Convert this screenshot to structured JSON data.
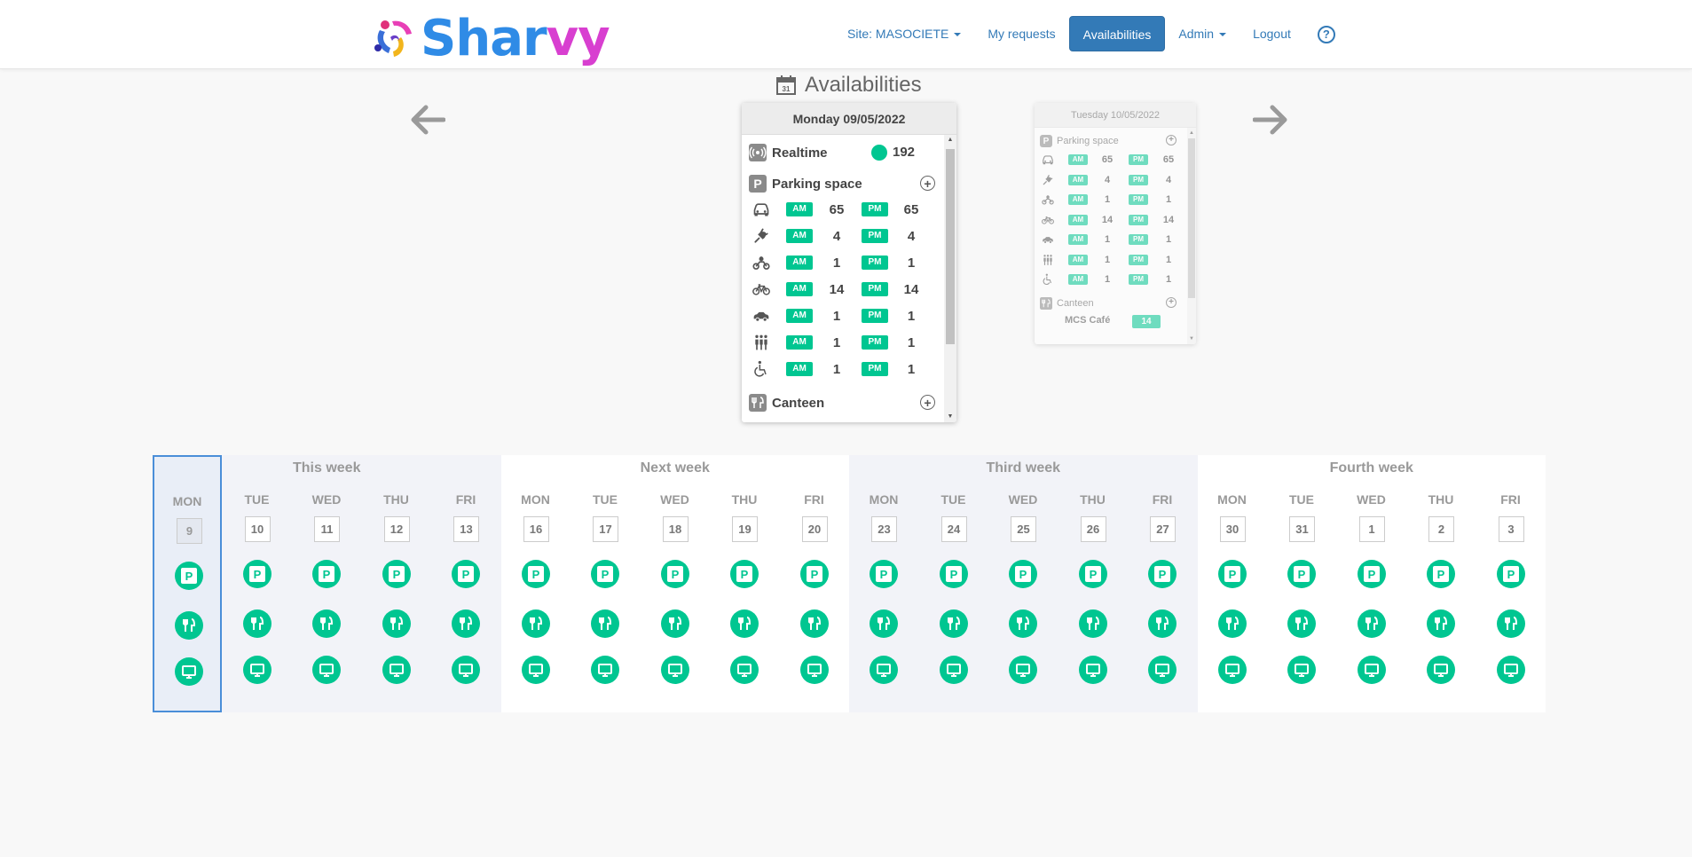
{
  "nav": {
    "logo_text_a": "Shar",
    "logo_text_b": "vy",
    "site_label": "Site: MASOCIETE",
    "my_requests": "My requests",
    "availabilities": "Availabilities",
    "admin": "Admin",
    "logout": "Logout",
    "help": "?"
  },
  "page": {
    "title": "Availabilities",
    "calendar_icon_day": "31"
  },
  "main_card": {
    "date": "Monday 09/05/2022",
    "realtime_label": "Realtime",
    "realtime_value": "192",
    "parking_label": "Parking space",
    "parking_icon": "P",
    "canteen_label": "Canteen",
    "am": "AM",
    "pm": "PM",
    "rows": [
      {
        "icon": "car-icon",
        "am": "65",
        "pm": "65"
      },
      {
        "icon": "plug-icon",
        "am": "4",
        "pm": "4"
      },
      {
        "icon": "motorbike-icon",
        "am": "1",
        "pm": "1"
      },
      {
        "icon": "bicycle-icon",
        "am": "14",
        "pm": "14"
      },
      {
        "icon": "small-car-icon",
        "am": "1",
        "pm": "1"
      },
      {
        "icon": "carpool-icon",
        "am": "1",
        "pm": "1"
      },
      {
        "icon": "wheelchair-icon",
        "am": "1",
        "pm": "1"
      }
    ]
  },
  "next_card": {
    "date": "Tuesday 10/05/2022",
    "parking_label": "Parking space",
    "canteen_label": "Canteen",
    "canteen_name": "MCS Café",
    "canteen_value": "14",
    "am": "AM",
    "pm": "PM",
    "rows": [
      {
        "icon": "car-icon",
        "am": "65",
        "pm": "65"
      },
      {
        "icon": "plug-icon",
        "am": "4",
        "pm": "4"
      },
      {
        "icon": "motorbike-icon",
        "am": "1",
        "pm": "1"
      },
      {
        "icon": "bicycle-icon",
        "am": "14",
        "pm": "14"
      },
      {
        "icon": "small-car-icon",
        "am": "1",
        "pm": "1"
      },
      {
        "icon": "carpool-icon",
        "am": "1",
        "pm": "1"
      },
      {
        "icon": "wheelchair-icon",
        "am": "1",
        "pm": "1"
      }
    ]
  },
  "calendar": {
    "weeks": [
      {
        "title": "This week",
        "days": [
          {
            "name": "MON",
            "num": "9",
            "selected": true
          },
          {
            "name": "TUE",
            "num": "10"
          },
          {
            "name": "WED",
            "num": "11"
          },
          {
            "name": "THU",
            "num": "12"
          },
          {
            "name": "FRI",
            "num": "13"
          }
        ]
      },
      {
        "title": "Next week",
        "days": [
          {
            "name": "MON",
            "num": "16"
          },
          {
            "name": "TUE",
            "num": "17"
          },
          {
            "name": "WED",
            "num": "18"
          },
          {
            "name": "THU",
            "num": "19"
          },
          {
            "name": "FRI",
            "num": "20"
          }
        ]
      },
      {
        "title": "Third week",
        "days": [
          {
            "name": "MON",
            "num": "23"
          },
          {
            "name": "TUE",
            "num": "24"
          },
          {
            "name": "WED",
            "num": "25"
          },
          {
            "name": "THU",
            "num": "26"
          },
          {
            "name": "FRI",
            "num": "27"
          }
        ]
      },
      {
        "title": "Fourth week",
        "days": [
          {
            "name": "MON",
            "num": "30"
          },
          {
            "name": "TUE",
            "num": "31"
          },
          {
            "name": "WED",
            "num": "1"
          },
          {
            "name": "THU",
            "num": "2"
          },
          {
            "name": "FRI",
            "num": "3"
          }
        ]
      }
    ]
  },
  "colors": {
    "accent": "#00c691",
    "primary": "#337ab7",
    "logo_blue": "#2f8be6",
    "logo_magenta": "#d83fd0"
  }
}
